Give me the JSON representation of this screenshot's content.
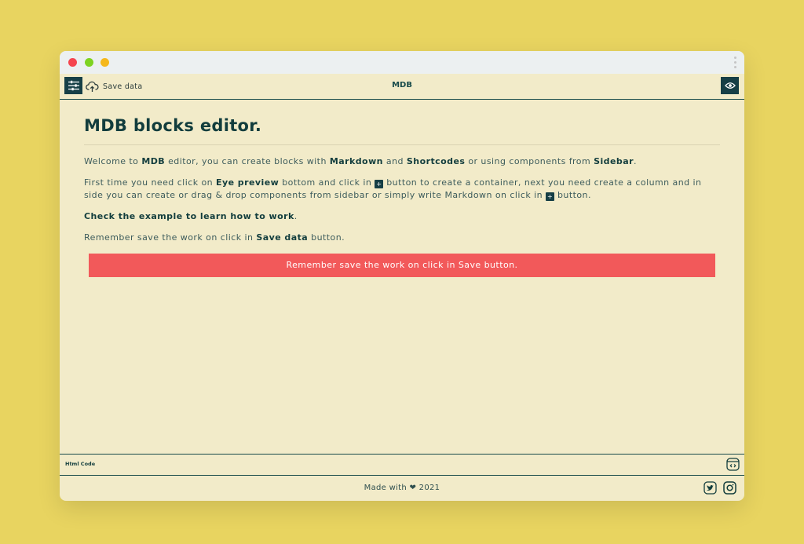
{
  "toolbar": {
    "save_label": "Save data",
    "title": "MDB"
  },
  "content": {
    "heading": "MDB blocks editor.",
    "p1": {
      "t1": "Welcome to ",
      "b1": "MDB",
      "t2": " editor, you can create blocks with ",
      "b2": "Markdown",
      "t3": " and ",
      "b3": "Shortcodes",
      "t4": " or using components from ",
      "b4": "Sidebar",
      "t5": "."
    },
    "p2": {
      "t1": "First time you need click on ",
      "b1": "Eye preview",
      "t2": " bottom and click in ",
      "t3": " button to create a container, next you need create a column and in side you can create or drag & drop components from sidebar or simply write Markdown on click in ",
      "t4": " button."
    },
    "plus_glyph": "+",
    "p3": {
      "b1": "Check the example to learn how to work",
      "t1": "."
    },
    "p4": {
      "t1": "Remember save the work on click in ",
      "b1": "Save data",
      "t2": " button."
    },
    "alert": "Remember save the work on click in Save button."
  },
  "htmlbar": {
    "label": "Html Code"
  },
  "footer": {
    "made_with": "Made with ❤ 2021"
  },
  "colors": {
    "accent": "#163f46",
    "alert": "#f2595a",
    "page_bg": "#e8d460",
    "window_bg": "#f2ebc9"
  },
  "icons": [
    "sliders-icon",
    "cloud-upload-icon",
    "eye-icon",
    "code-icon",
    "twitter-icon",
    "instagram-icon"
  ]
}
